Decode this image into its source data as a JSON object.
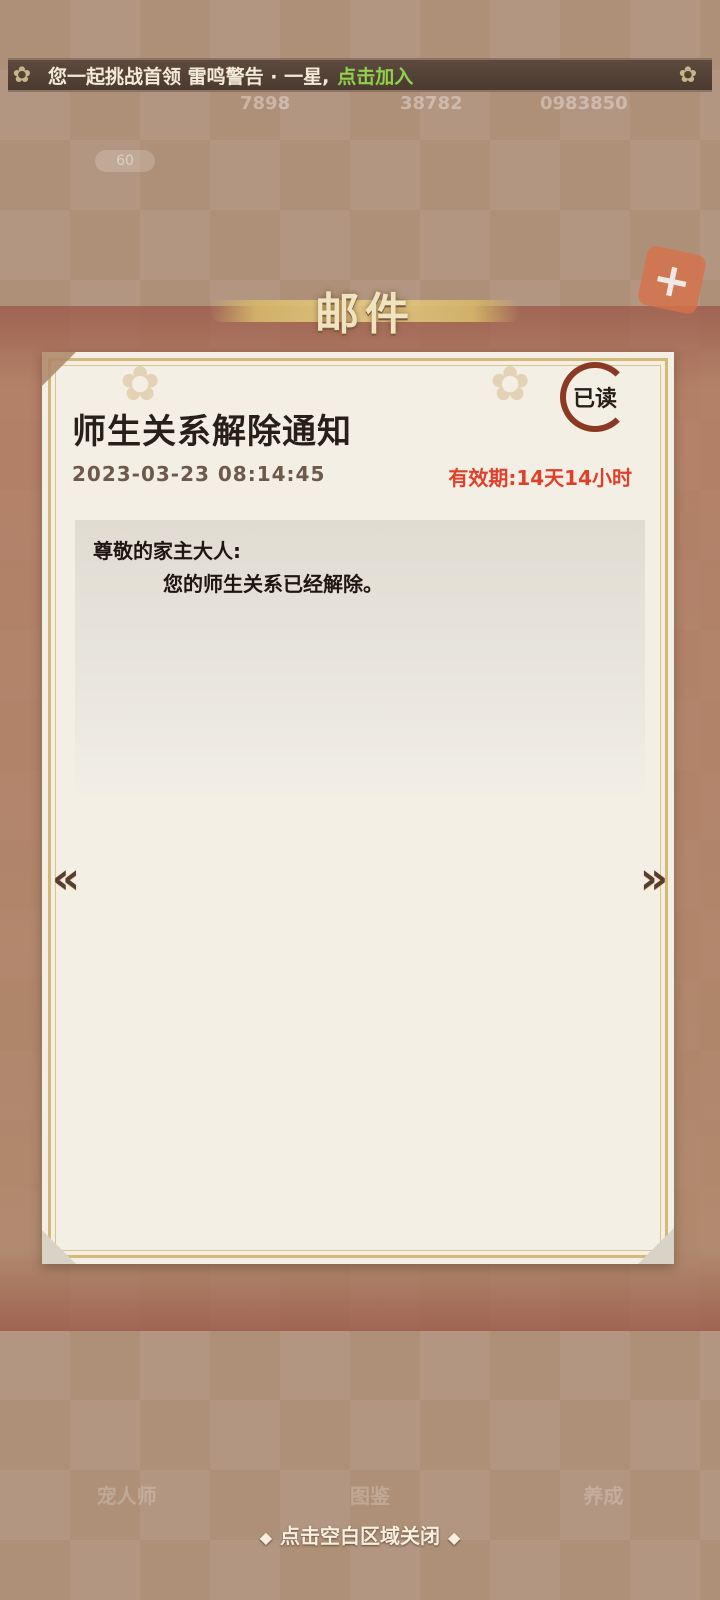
{
  "banner": {
    "message": "您一起挑战首领 雷鸣警告 · 一星,",
    "join_label": "点击加入"
  },
  "background": {
    "resources": [
      "7898",
      "38782",
      "0983850"
    ],
    "level": "60",
    "nav": [
      "宠人师",
      "图鉴",
      "养成"
    ]
  },
  "header": {
    "title": "邮件"
  },
  "mail": {
    "title": "师生关系解除通知",
    "read_status": "已读",
    "date": "2023-03-23 08:14:45",
    "validity": "有效期:14天14小时",
    "greeting": "尊敬的家主大人:",
    "body": "您的师生关系已经解除。"
  },
  "footer": {
    "close_hint": "点击空白区域关闭"
  },
  "colors": {
    "validity": "#e0402a",
    "join": "#8fd14b",
    "stamp": "#8a3a22"
  },
  "icons": {
    "prev": "chevron-left-icon",
    "next": "chevron-right-icon",
    "banner_flower": "sakura-icon"
  }
}
